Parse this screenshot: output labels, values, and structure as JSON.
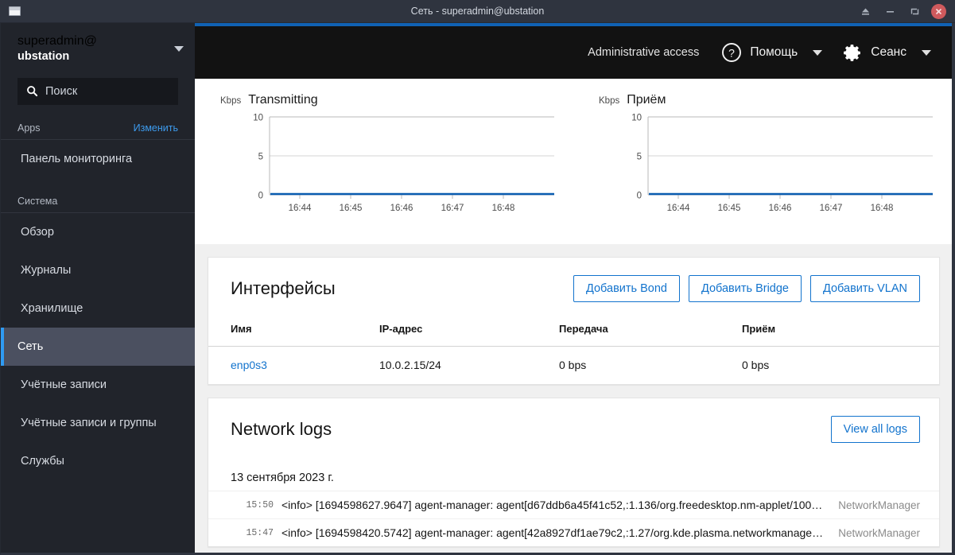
{
  "window": {
    "title": "Сеть - superadmin@ubstation",
    "app_icon": "window-icon",
    "controls": {
      "eject_label": "▲",
      "minimize_label": "−",
      "maximize_label": "❐",
      "close_label": "✕"
    }
  },
  "sidebar": {
    "user": {
      "line1": "superadmin@",
      "line2": "ubstation",
      "caret": "chevron-down-icon"
    },
    "search": {
      "placeholder": "Поиск",
      "value": "",
      "icon": "search-icon"
    },
    "groups": [
      {
        "header_label": "Apps",
        "header_action": "Изменить",
        "items": [
          {
            "label": "Панель мониторинга",
            "active": false
          }
        ]
      },
      {
        "header_label": "Система",
        "header_action": "",
        "items": [
          {
            "label": "Обзор",
            "active": false
          },
          {
            "label": "Журналы",
            "active": false
          },
          {
            "label": "Хранилище",
            "active": false
          },
          {
            "label": "Сеть",
            "active": true
          },
          {
            "label": "Учётные записи",
            "active": false
          },
          {
            "label": "Учётные записи и группы",
            "active": false
          },
          {
            "label": "Службы",
            "active": false
          }
        ]
      }
    ]
  },
  "topbar": {
    "admin_access": "Administrative access",
    "help": {
      "label": "Помощь",
      "icon": "question-circle-icon",
      "caret": "chevron-down-icon"
    },
    "session": {
      "label": "Сеанс",
      "icon": "gear-icon",
      "caret": "chevron-down-icon"
    }
  },
  "chart_data": [
    {
      "type": "line",
      "title": "Transmitting",
      "ylabel": "Kbps",
      "xlabel": "",
      "x": [
        "16:44",
        "16:45",
        "16:46",
        "16:47",
        "16:48"
      ],
      "yticks": [
        0,
        5,
        10
      ],
      "ylim": [
        0,
        10
      ],
      "grid": true,
      "series": [
        {
          "name": "Transmitting",
          "color": "#0a5cb0",
          "values": [
            0,
            0,
            0,
            0,
            0
          ]
        }
      ]
    },
    {
      "type": "line",
      "title": "Приём",
      "ylabel": "Kbps",
      "xlabel": "",
      "x": [
        "16:44",
        "16:45",
        "16:46",
        "16:47",
        "16:48"
      ],
      "yticks": [
        0,
        5,
        10
      ],
      "ylim": [
        0,
        10
      ],
      "grid": true,
      "series": [
        {
          "name": "Приём",
          "color": "#0a5cb0",
          "values": [
            0,
            0,
            0,
            0,
            0
          ]
        }
      ]
    }
  ],
  "interfaces_card": {
    "title": "Интерфейсы",
    "buttons": [
      {
        "label": "Добавить Bond"
      },
      {
        "label": "Добавить Bridge"
      },
      {
        "label": "Добавить VLAN"
      }
    ],
    "columns": [
      "Имя",
      "IP-адрес",
      "Передача",
      "Приём"
    ],
    "rows": [
      {
        "name": "enp0s3",
        "ip": "10.0.2.15/24",
        "tx": "0 bps",
        "rx": "0 bps"
      }
    ]
  },
  "logs_card": {
    "title": "Network logs",
    "view_all_label": "View all logs",
    "date": "13 сентября 2023 г.",
    "entries": [
      {
        "time": "15:50",
        "message": "<info> [1694598627.9647] agent-manager: agent[d67ddb6a45f41c52,:1.136/org.freedesktop.nm-applet/100…",
        "source": "NetworkManager"
      },
      {
        "time": "15:47",
        "message": "<info> [1694598420.5742] agent-manager: agent[42a8927df1ae79c2,:1.27/org.kde.plasma.networkmanagem…",
        "source": "NetworkManager"
      }
    ]
  },
  "colors": {
    "accent_blue": "#1273cd",
    "loadbar_blue": "#1062b4",
    "sidebar_bg": "#21242b",
    "sidebar_active_bg": "#4b5060",
    "titlebar_bg": "#2f343f",
    "topbar_bg": "#121212",
    "close_red": "#cf5a5d",
    "chart_line": "#0a5cb0"
  }
}
